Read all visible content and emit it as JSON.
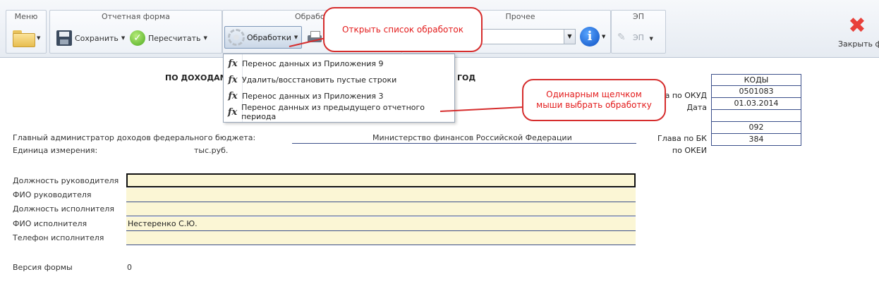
{
  "ribbon": {
    "groups": {
      "menu": "Меню",
      "report_form": "Отчетная форма",
      "processing": "Обработ",
      "other": "Прочее",
      "ep": "ЭП"
    },
    "save_label": "Сохранить",
    "recalc_label": "Пересчитать",
    "processing_button": "Обработки",
    "ep_button": "ЭП",
    "close_label": "Закрыть форм"
  },
  "processing_menu": {
    "items": [
      {
        "label": "Перенос данных из Приложения 9"
      },
      {
        "label": "Удалить/восстановить пустые строки"
      },
      {
        "label": "Перенос данных из Приложения 3"
      },
      {
        "label": "Перенос данных из предыдущего отчетного периода"
      }
    ]
  },
  "callouts": {
    "open_list": "Открыть список обработок",
    "single_click": "Одинарным щелчком мыши выбрать обработку"
  },
  "form": {
    "title_left": "ПО ДОХОДАМ",
    "title_right": "ГОД",
    "codes_header": "КОДЫ",
    "codes": [
      {
        "label": "а по ОКУД",
        "value": "0501083"
      },
      {
        "label": "Дата",
        "value": "01.03.2014"
      },
      {
        "label": "",
        "value": ""
      },
      {
        "label": "Глава по БК",
        "value": "092"
      },
      {
        "label": "по ОКЕИ",
        "value": "384"
      }
    ],
    "admin_label": "Главный администратор доходов федерального бюджета:",
    "admin_value": "Министерство финансов Российской Федерации",
    "unit_label": "Единица измерения:",
    "unit_value": "тыс.руб.",
    "fields": [
      {
        "label": "Должность руководителя",
        "value": ""
      },
      {
        "label": "ФИО руководителя",
        "value": ""
      },
      {
        "label": "Должность исполнителя",
        "value": ""
      },
      {
        "label": "ФИО исполнителя",
        "value": "Нестеренко С.Ю."
      },
      {
        "label": "Телефон исполнителя",
        "value": ""
      }
    ],
    "version_label": "Версия формы",
    "version_value": "0"
  },
  "colors": {
    "callout_red": "#e31b1b",
    "field_bg": "#fbf6d5",
    "border_blue": "#3b4f8a"
  },
  "icons": [
    "folder-icon",
    "save-icon",
    "check-icon",
    "gear-icon",
    "printer-icon",
    "info-icon",
    "pen-icon",
    "close-icon",
    "fx-icon"
  ]
}
